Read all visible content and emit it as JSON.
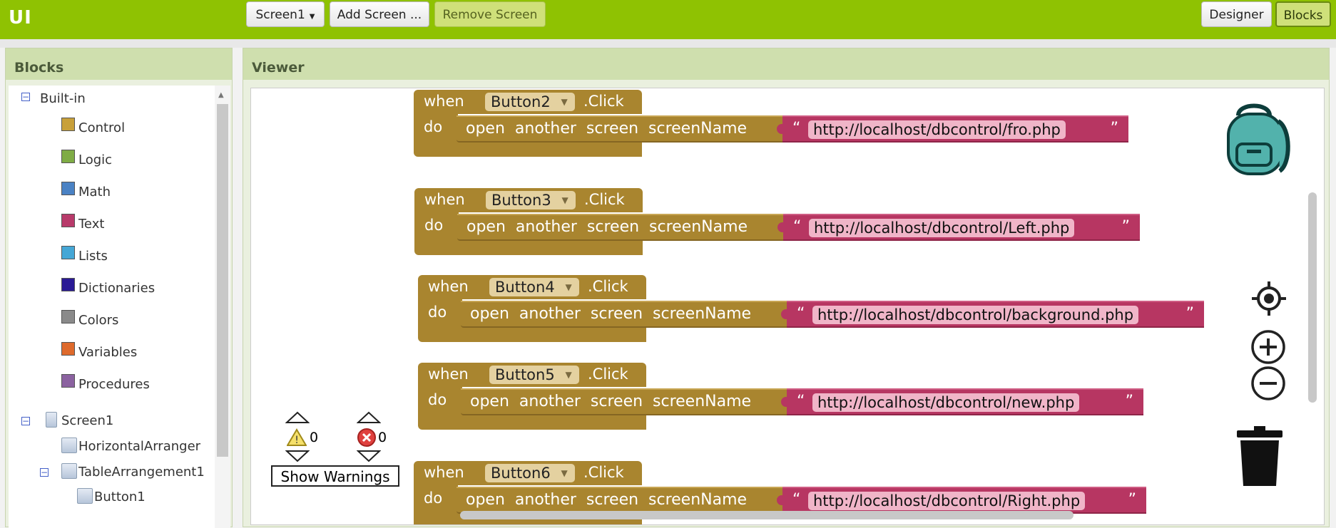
{
  "header": {
    "app_title": "UI",
    "screen_select": "Screen1",
    "add_screen": "Add Screen ...",
    "remove_screen": "Remove Screen",
    "designer": "Designer",
    "blocks": "Blocks"
  },
  "blocks_panel": {
    "title": "Blocks",
    "built_in_label": "Built-in",
    "categories": [
      {
        "label": "Control",
        "color": "#c8a03a"
      },
      {
        "label": "Logic",
        "color": "#7fac45"
      },
      {
        "label": "Math",
        "color": "#4a82c4"
      },
      {
        "label": "Text",
        "color": "#b83a6a"
      },
      {
        "label": "Lists",
        "color": "#45a7d6"
      },
      {
        "label": "Dictionaries",
        "color": "#2a1a95"
      },
      {
        "label": "Colors",
        "color": "#8a8a8a"
      },
      {
        "label": "Variables",
        "color": "#de6a2c"
      },
      {
        "label": "Procedures",
        "color": "#8b62a0"
      }
    ],
    "components": {
      "screen": "Screen1",
      "horizontal": "HorizontalArranger",
      "table": "TableArrangement1",
      "button": "Button1"
    }
  },
  "viewer": {
    "title": "Viewer",
    "events": [
      {
        "when": "when",
        "component": "Button2",
        "event": ".Click",
        "do": "do",
        "call": "open  another  screen  screenName",
        "quote_open": "“",
        "url": "http://localhost/dbcontrol/fro.php",
        "quote_close": "”"
      },
      {
        "when": "when",
        "component": "Button3",
        "event": ".Click",
        "do": "do",
        "call": "open  another  screen  screenName",
        "quote_open": "“",
        "url": "http://localhost/dbcontrol/Left.php",
        "quote_close": "”"
      },
      {
        "when": "when",
        "component": "Button4",
        "event": ".Click",
        "do": "do",
        "call": "open  another  screen  screenName",
        "quote_open": "“",
        "url": "http://localhost/dbcontrol/background.php",
        "quote_close": "”"
      },
      {
        "when": "when",
        "component": "Button5",
        "event": ".Click",
        "do": "do",
        "call": "open  another  screen  screenName",
        "quote_open": "“",
        "url": "http://localhost/dbcontrol/new.php",
        "quote_close": "”"
      },
      {
        "when": "when",
        "component": "Button6",
        "event": ".Click",
        "do": "do",
        "call": "open  another  screen  screenName",
        "quote_open": "“",
        "url": "http://localhost/dbcontrol/Right.php",
        "quote_close": "”"
      }
    ],
    "warnings_count": "0",
    "errors_count": "0",
    "show_warnings": "Show Warnings",
    "icons": [
      "backpack-icon",
      "center-target-icon",
      "zoom-in-icon",
      "zoom-out-icon",
      "trash-icon"
    ]
  }
}
